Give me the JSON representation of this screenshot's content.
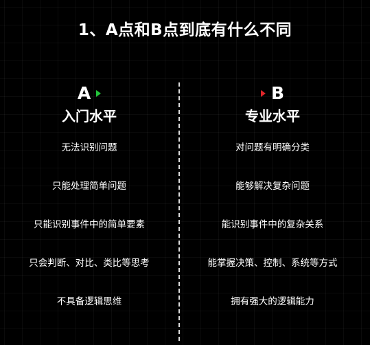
{
  "title": "1、A点和B点到底有什么不同",
  "colors": {
    "background": "#000000",
    "text": "#ffffff",
    "arrow_a": "#22c43a",
    "arrow_b": "#e0262a",
    "divider": "#dcdcdc"
  },
  "left": {
    "letter": "A",
    "level": "入门水平",
    "items": [
      "无法识别问题",
      "只能处理简单问题",
      "只能识别事件中的简单要素",
      "只会判断、对比、类比等思考",
      "不具备逻辑思维"
    ]
  },
  "right": {
    "letter": "B",
    "level": "专业水平",
    "items": [
      "对问题有明确分类",
      "能够解决复杂问题",
      "能识别事件中的复杂关系",
      "能掌握决策、控制、系统等方式",
      "拥有强大的逻辑能力"
    ]
  }
}
